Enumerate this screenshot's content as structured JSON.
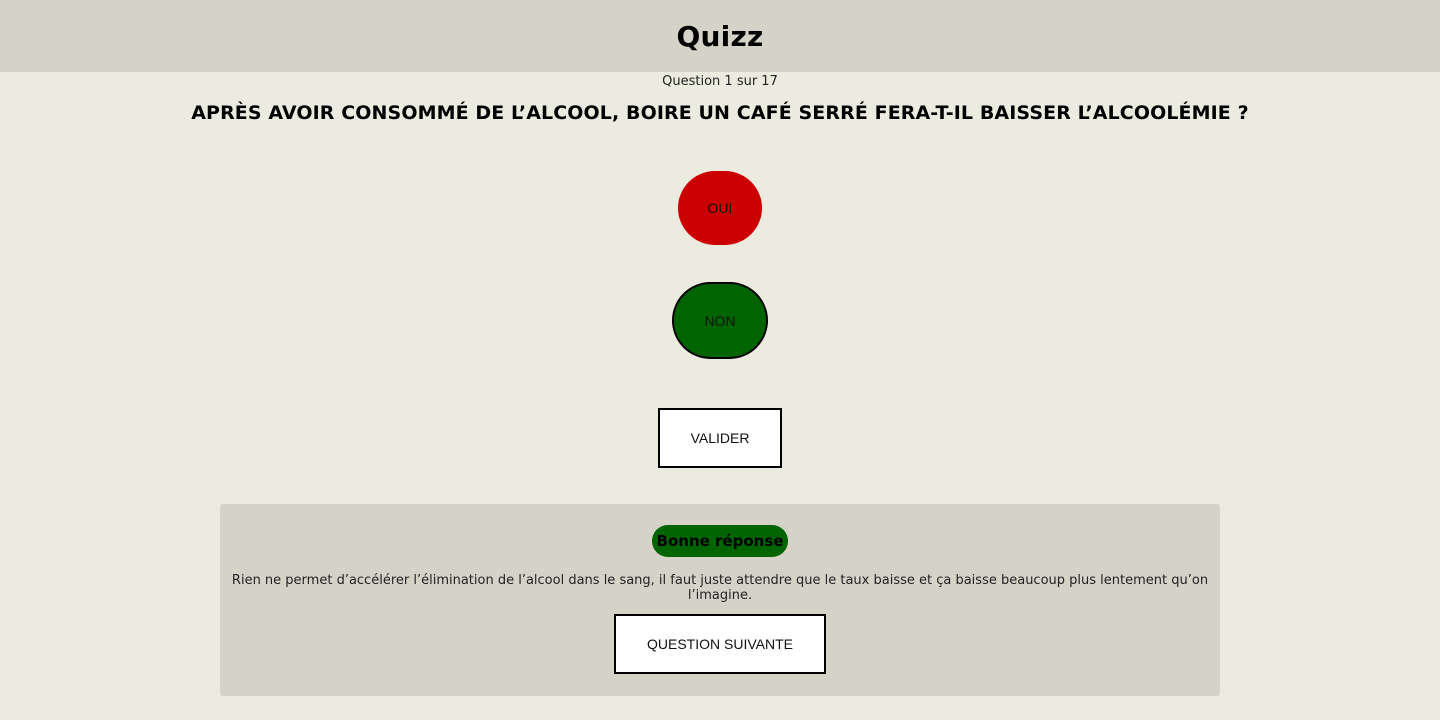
{
  "header": {
    "title": "Quizz"
  },
  "progress": {
    "text": "Question 1 sur 17"
  },
  "question": {
    "text": "APRÈS AVOIR CONSOMMÉ DE L’ALCOOL, BOIRE UN CAFÉ SERRÉ FERA-T-IL BAISSER L’ALCOOLÉMIE ?"
  },
  "answers": {
    "oui": {
      "label": "OUI",
      "color": "#cc0000"
    },
    "non": {
      "label": "NON",
      "color": "#006400",
      "selected": true
    }
  },
  "validate_button": {
    "label": "VALIDER"
  },
  "feedback": {
    "badge": "Bonne réponse",
    "badge_color": "#006400",
    "explanation": "Rien ne permet d’accélérer l’élimination de l’alcool dans le sang, il faut juste attendre que le taux baisse et ça baisse beaucoup plus lentement qu’on l’imagine.",
    "next_button": "QUESTION SUIVANTE"
  }
}
